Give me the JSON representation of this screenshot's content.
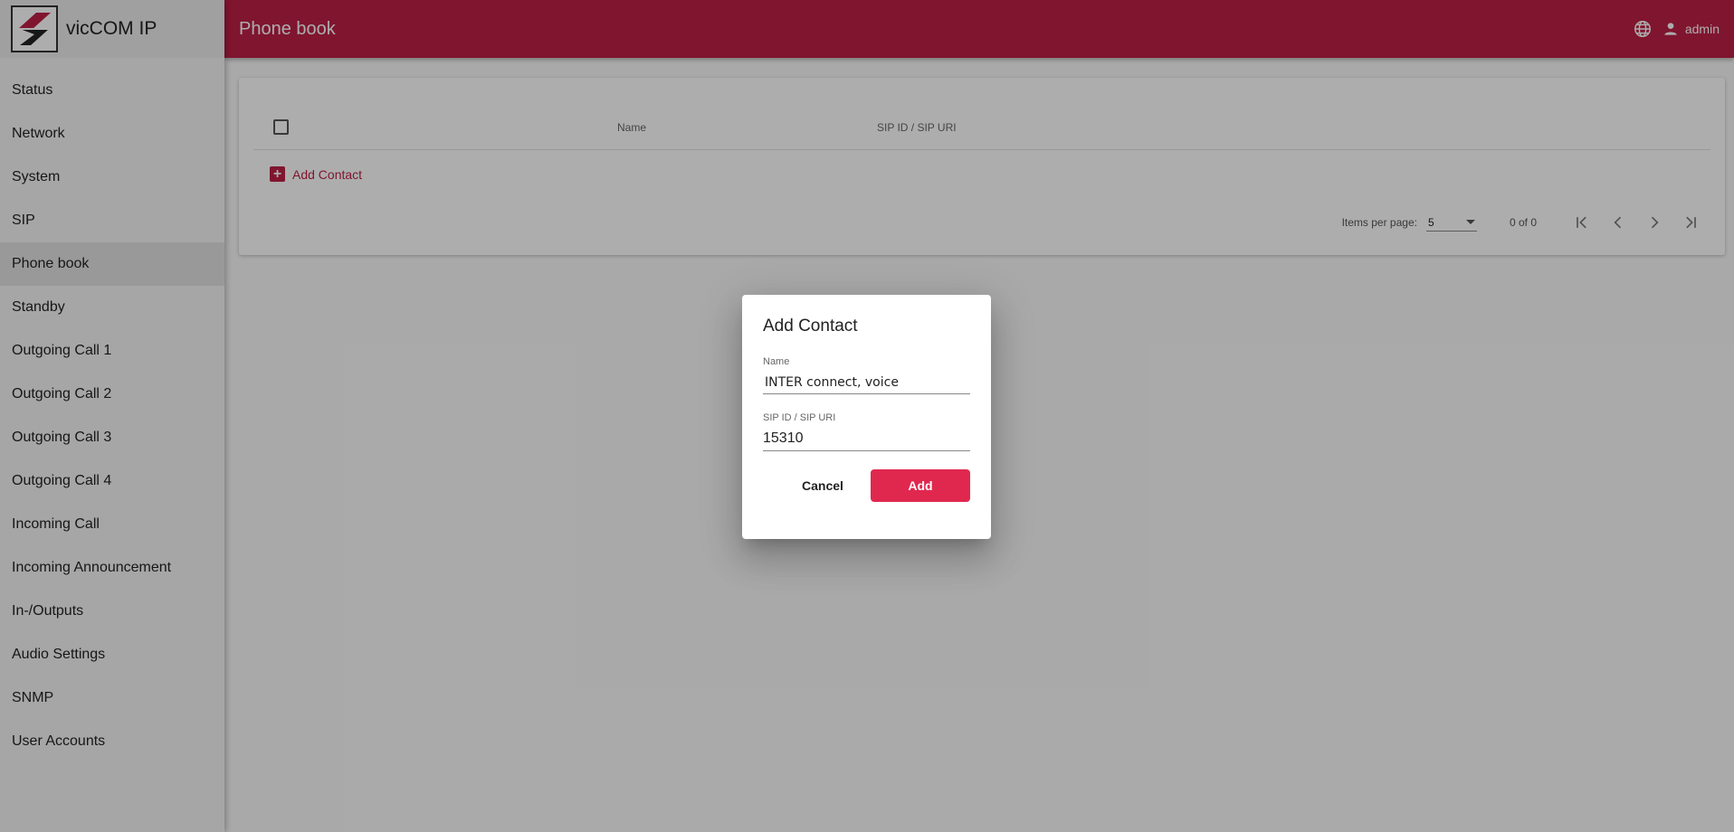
{
  "app": {
    "title": "vicCOM IP"
  },
  "header": {
    "title": "Phone book",
    "user": "admin"
  },
  "sidebar": {
    "items": [
      {
        "label": "Status"
      },
      {
        "label": "Network"
      },
      {
        "label": "System"
      },
      {
        "label": "SIP"
      },
      {
        "label": "Phone book"
      },
      {
        "label": "Standby"
      },
      {
        "label": "Outgoing Call 1"
      },
      {
        "label": "Outgoing Call 2"
      },
      {
        "label": "Outgoing Call 3"
      },
      {
        "label": "Outgoing Call 4"
      },
      {
        "label": "Incoming Call"
      },
      {
        "label": "Incoming Announcement"
      },
      {
        "label": "In-/Outputs"
      },
      {
        "label": "Audio Settings"
      },
      {
        "label": "SNMP"
      },
      {
        "label": "User Accounts"
      }
    ],
    "active": "Phone book"
  },
  "table": {
    "columns": [
      "Name",
      "SIP ID / SIP URI"
    ],
    "add_label": "Add Contact"
  },
  "paginator": {
    "items_per_page_label": "Items per page:",
    "items_per_page": "5",
    "range": "0 of 0"
  },
  "dialog": {
    "title": "Add Contact",
    "name_label": "Name",
    "name_value": "INTER connect, voice",
    "sip_label": "SIP ID / SIP URI",
    "sip_value": "15310",
    "cancel_label": "Cancel",
    "add_label": "Add"
  },
  "colors": {
    "brand": "#bd1f46",
    "accent": "#e0284f"
  },
  "icons": [
    "logo-icon",
    "globe-icon",
    "user-icon",
    "add-icon",
    "first-page-icon",
    "prev-page-icon",
    "next-page-icon",
    "last-page-icon",
    "dropdown-caret-icon"
  ]
}
